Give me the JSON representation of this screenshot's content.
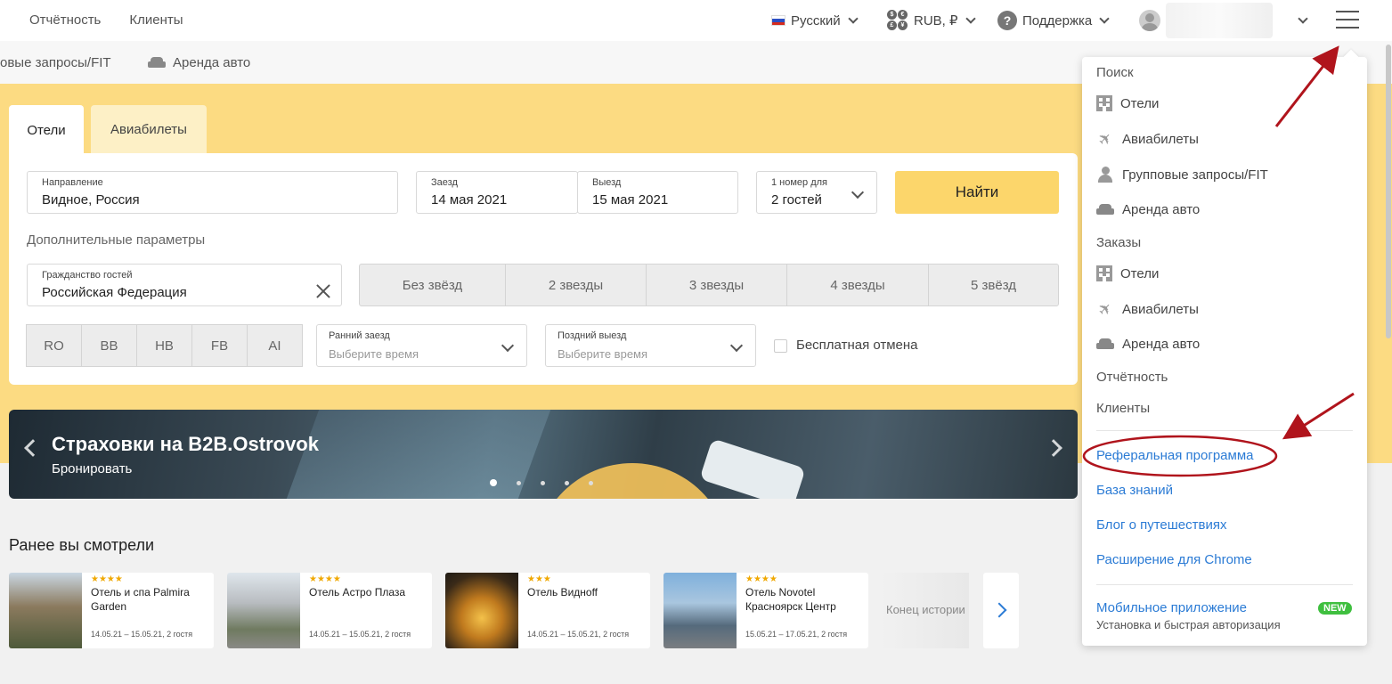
{
  "header": {
    "nav": [
      "Отчётность",
      "Клиенты"
    ],
    "language": "Русский",
    "currency": "RUB, ₽",
    "support": "Поддержка"
  },
  "subnav": {
    "item1": "овые запросы/FIT",
    "item2": "Аренда авто"
  },
  "search": {
    "tabs": [
      "Отели",
      "Авиабилеты"
    ],
    "destination_label": "Направление",
    "destination_value": "Видное, Россия",
    "checkin_label": "Заезд",
    "checkin_value": "14 мая 2021",
    "checkout_label": "Выезд",
    "checkout_value": "15 мая 2021",
    "rooms_label": "1 номер для",
    "rooms_value": "2 гостей",
    "find_button": "Найти",
    "additional": "Дополнительные параметры",
    "citizenship_label": "Гражданство гостей",
    "citizenship_value": "Российская Федерация",
    "stars": [
      "Без звёзд",
      "2 звезды",
      "3 звезды",
      "4 звезды",
      "5 звёзд"
    ],
    "meals": [
      "RO",
      "BB",
      "HB",
      "FB",
      "AI"
    ],
    "early_label": "Ранний заезд",
    "early_placeholder": "Выберите время",
    "late_label": "Поздний выезд",
    "late_placeholder": "Выберите время",
    "free_cancel": "Бесплатная отмена"
  },
  "banner": {
    "title": "Страховки на B2B.Ostrovok",
    "subtitle": "Бронировать"
  },
  "recent": {
    "title": "Ранее вы смотрели",
    "cards": [
      {
        "stars": "★★★★",
        "name": "Отель и спа Palmira Garden",
        "dates": "14.05.21 – 15.05.21, 2 гостя"
      },
      {
        "stars": "★★★★",
        "name": "Отель Астро Плаза",
        "dates": "14.05.21 – 15.05.21, 2 гостя"
      },
      {
        "stars": "★★★",
        "name": "Отель Видноff",
        "dates": "14.05.21 – 15.05.21, 2 гостя"
      },
      {
        "stars": "★★★★",
        "name": "Отель Novotel Красноярск Центр",
        "dates": "15.05.21 – 17.05.21, 2 гостя"
      }
    ],
    "end_text": "Конец истории"
  },
  "menu": {
    "search_section": "Поиск",
    "search_items": [
      "Отели",
      "Авиабилеты",
      "Групповые запросы/FIT",
      "Аренда авто"
    ],
    "orders_section": "Заказы",
    "orders_items": [
      "Отели",
      "Авиабилеты",
      "Аренда авто"
    ],
    "reports": "Отчётность",
    "clients": "Клиенты",
    "links": [
      "Реферальная программа",
      "База знаний",
      "Блог о путешествиях",
      "Расширение для Chrome"
    ],
    "mobile_app": "Мобильное приложение",
    "mobile_badge": "NEW",
    "mobile_sub": "Установка и быстрая авторизация"
  },
  "colors": {
    "accent_yellow": "#fcdb82",
    "button_yellow": "#fcd66b",
    "link_blue": "#2b7bd5",
    "annotation_red": "#b0141c"
  }
}
